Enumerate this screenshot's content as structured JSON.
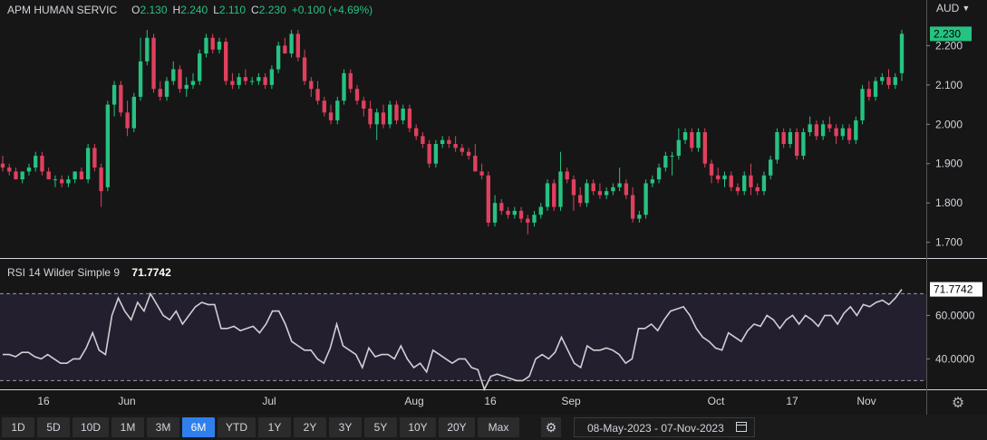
{
  "legend": {
    "symbol": "APM HUMAN SERVIC",
    "open_label": "O",
    "open": "2.130",
    "high_label": "H",
    "high": "2.240",
    "low_label": "L",
    "low": "2.110",
    "close_label": "C",
    "close": "2.230",
    "change": "+0.100 (+4.69%)"
  },
  "currency": "AUD",
  "currency_icon": "chevron-down-icon",
  "rsi_legend": {
    "name": "RSI 14 Wilder Simple 9",
    "value": "71.7742"
  },
  "colors": {
    "up": "#26c281",
    "down": "#e0405e",
    "rsi_line": "#cfcfd4",
    "rsi_band": "#231f2e",
    "active": "#2f80ed"
  },
  "toolbar": {
    "ranges": [
      "1D",
      "5D",
      "10D",
      "1M",
      "3M",
      "6M",
      "YTD",
      "1Y",
      "2Y",
      "3Y",
      "5Y",
      "10Y",
      "20Y",
      "Max"
    ],
    "active": "6M",
    "date_range": "08-May-2023 - 07-Nov-2023",
    "gear_icon": "gear-icon",
    "calendar_icon": "calendar-icon"
  },
  "settings_icon": "settings-icon",
  "chart_data": [
    {
      "type": "candlestick",
      "currency": "AUD",
      "last_price_label": "2.230",
      "y_ticks": [
        "2.200",
        "2.100",
        "2.000",
        "1.900",
        "1.800",
        "1.700"
      ],
      "ylim": [
        1.66,
        2.27
      ],
      "x_ticks": [
        "16",
        "Jun",
        "Jul",
        "Aug",
        "16",
        "Sep",
        "Oct",
        "17",
        "Nov"
      ],
      "candles": [
        [
          1.9,
          1.92,
          1.88,
          1.89
        ],
        [
          1.89,
          1.9,
          1.87,
          1.88
        ],
        [
          1.88,
          1.89,
          1.86,
          1.86
        ],
        [
          1.86,
          1.88,
          1.85,
          1.88
        ],
        [
          1.88,
          1.9,
          1.87,
          1.89
        ],
        [
          1.89,
          1.93,
          1.88,
          1.92
        ],
        [
          1.92,
          1.93,
          1.87,
          1.88
        ],
        [
          1.88,
          1.89,
          1.86,
          1.86
        ],
        [
          1.86,
          1.87,
          1.84,
          1.86
        ],
        [
          1.86,
          1.87,
          1.84,
          1.85
        ],
        [
          1.85,
          1.87,
          1.84,
          1.86
        ],
        [
          1.86,
          1.88,
          1.85,
          1.88
        ],
        [
          1.88,
          1.89,
          1.86,
          1.86
        ],
        [
          1.86,
          1.95,
          1.85,
          1.94
        ],
        [
          1.94,
          1.95,
          1.88,
          1.89
        ],
        [
          1.89,
          1.9,
          1.79,
          1.83
        ],
        [
          1.84,
          2.06,
          1.83,
          2.05
        ],
        [
          2.05,
          2.11,
          2.02,
          2.1
        ],
        [
          2.1,
          2.11,
          2.02,
          2.03
        ],
        [
          2.03,
          2.06,
          1.97,
          1.99
        ],
        [
          1.99,
          2.08,
          1.98,
          2.07
        ],
        [
          2.07,
          2.22,
          2.06,
          2.16
        ],
        [
          2.16,
          2.24,
          2.15,
          2.22
        ],
        [
          2.22,
          2.23,
          2.08,
          2.09
        ],
        [
          2.09,
          2.11,
          2.06,
          2.07
        ],
        [
          2.07,
          2.12,
          2.06,
          2.11
        ],
        [
          2.11,
          2.16,
          2.1,
          2.14
        ],
        [
          2.14,
          2.15,
          2.08,
          2.09
        ],
        [
          2.09,
          2.12,
          2.07,
          2.1
        ],
        [
          2.1,
          2.13,
          2.09,
          2.11
        ],
        [
          2.11,
          2.19,
          2.1,
          2.18
        ],
        [
          2.18,
          2.23,
          2.17,
          2.22
        ],
        [
          2.22,
          2.23,
          2.18,
          2.19
        ],
        [
          2.19,
          2.22,
          2.18,
          2.21
        ],
        [
          2.21,
          2.22,
          2.1,
          2.11
        ],
        [
          2.11,
          2.13,
          2.09,
          2.1
        ],
        [
          2.1,
          2.13,
          2.09,
          2.12
        ],
        [
          2.12,
          2.14,
          2.1,
          2.11
        ],
        [
          2.11,
          2.12,
          2.1,
          2.11
        ],
        [
          2.11,
          2.13,
          2.1,
          2.12
        ],
        [
          2.12,
          2.13,
          2.09,
          2.1
        ],
        [
          2.1,
          2.15,
          2.09,
          2.14
        ],
        [
          2.14,
          2.21,
          2.13,
          2.2
        ],
        [
          2.2,
          2.22,
          2.18,
          2.18
        ],
        [
          2.18,
          2.24,
          2.17,
          2.23
        ],
        [
          2.23,
          2.24,
          2.16,
          2.17
        ],
        [
          2.17,
          2.19,
          2.1,
          2.11
        ],
        [
          2.11,
          2.12,
          2.07,
          2.09
        ],
        [
          2.09,
          2.11,
          2.05,
          2.06
        ],
        [
          2.06,
          2.07,
          2.02,
          2.03
        ],
        [
          2.03,
          2.05,
          2.0,
          2.01
        ],
        [
          2.01,
          2.07,
          2.0,
          2.06
        ],
        [
          2.06,
          2.14,
          2.05,
          2.13
        ],
        [
          2.13,
          2.14,
          2.08,
          2.09
        ],
        [
          2.09,
          2.1,
          2.05,
          2.06
        ],
        [
          2.06,
          2.07,
          2.02,
          2.04
        ],
        [
          2.04,
          2.06,
          1.99,
          2.0
        ],
        [
          2.0,
          2.04,
          1.96,
          2.03
        ],
        [
          2.03,
          2.05,
          1.99,
          2.0
        ],
        [
          2.0,
          2.06,
          1.99,
          2.05
        ],
        [
          2.05,
          2.06,
          2.0,
          2.01
        ],
        [
          2.01,
          2.05,
          2.0,
          2.04
        ],
        [
          2.04,
          2.05,
          1.98,
          1.99
        ],
        [
          1.99,
          2.0,
          1.96,
          1.97
        ],
        [
          1.97,
          1.98,
          1.94,
          1.95
        ],
        [
          1.95,
          1.96,
          1.89,
          1.9
        ],
        [
          1.9,
          1.96,
          1.89,
          1.95
        ],
        [
          1.95,
          1.97,
          1.94,
          1.96
        ],
        [
          1.96,
          1.97,
          1.94,
          1.95
        ],
        [
          1.95,
          1.97,
          1.93,
          1.94
        ],
        [
          1.94,
          1.95,
          1.92,
          1.93
        ],
        [
          1.93,
          1.94,
          1.91,
          1.92
        ],
        [
          1.92,
          1.95,
          1.9,
          1.88
        ],
        [
          1.88,
          1.9,
          1.86,
          1.87
        ],
        [
          1.87,
          1.88,
          1.74,
          1.75
        ],
        [
          1.75,
          1.82,
          1.74,
          1.8
        ],
        [
          1.8,
          1.81,
          1.77,
          1.78
        ],
        [
          1.78,
          1.79,
          1.76,
          1.77
        ],
        [
          1.77,
          1.79,
          1.76,
          1.78
        ],
        [
          1.78,
          1.79,
          1.75,
          1.76
        ],
        [
          1.76,
          1.77,
          1.72,
          1.75
        ],
        [
          1.75,
          1.78,
          1.74,
          1.77
        ],
        [
          1.77,
          1.8,
          1.76,
          1.79
        ],
        [
          1.79,
          1.86,
          1.78,
          1.85
        ],
        [
          1.85,
          1.86,
          1.78,
          1.79
        ],
        [
          1.79,
          1.93,
          1.78,
          1.88
        ],
        [
          1.88,
          1.89,
          1.85,
          1.86
        ],
        [
          1.86,
          1.87,
          1.78,
          1.82
        ],
        [
          1.82,
          1.84,
          1.79,
          1.8
        ],
        [
          1.8,
          1.86,
          1.79,
          1.85
        ],
        [
          1.85,
          1.86,
          1.82,
          1.83
        ],
        [
          1.83,
          1.85,
          1.81,
          1.82
        ],
        [
          1.82,
          1.84,
          1.81,
          1.83
        ],
        [
          1.83,
          1.85,
          1.82,
          1.84
        ],
        [
          1.84,
          1.89,
          1.83,
          1.85
        ],
        [
          1.85,
          1.86,
          1.81,
          1.82
        ],
        [
          1.82,
          1.84,
          1.75,
          1.76
        ],
        [
          1.76,
          1.78,
          1.75,
          1.77
        ],
        [
          1.77,
          1.86,
          1.76,
          1.85
        ],
        [
          1.85,
          1.87,
          1.84,
          1.86
        ],
        [
          1.86,
          1.9,
          1.85,
          1.89
        ],
        [
          1.89,
          1.93,
          1.88,
          1.92
        ],
        [
          1.92,
          1.93,
          1.87,
          1.92
        ],
        [
          1.92,
          1.99,
          1.91,
          1.96
        ],
        [
          1.96,
          1.99,
          1.95,
          1.98
        ],
        [
          1.98,
          1.99,
          1.93,
          1.94
        ],
        [
          1.94,
          1.99,
          1.93,
          1.98
        ],
        [
          1.98,
          1.99,
          1.89,
          1.9
        ],
        [
          1.9,
          1.91,
          1.85,
          1.87
        ],
        [
          1.87,
          1.89,
          1.85,
          1.86
        ],
        [
          1.86,
          1.88,
          1.84,
          1.87
        ],
        [
          1.87,
          1.88,
          1.83,
          1.84
        ],
        [
          1.84,
          1.85,
          1.82,
          1.83
        ],
        [
          1.83,
          1.88,
          1.82,
          1.87
        ],
        [
          1.87,
          1.9,
          1.82,
          1.84
        ],
        [
          1.84,
          1.85,
          1.82,
          1.83
        ],
        [
          1.83,
          1.88,
          1.82,
          1.87
        ],
        [
          1.87,
          1.92,
          1.86,
          1.91
        ],
        [
          1.91,
          1.99,
          1.9,
          1.98
        ],
        [
          1.98,
          1.99,
          1.94,
          1.95
        ],
        [
          1.95,
          1.99,
          1.94,
          1.98
        ],
        [
          1.98,
          1.99,
          1.91,
          1.92
        ],
        [
          1.92,
          1.99,
          1.91,
          1.98
        ],
        [
          1.98,
          2.02,
          1.97,
          2.0
        ],
        [
          2.0,
          2.01,
          1.96,
          1.97
        ],
        [
          1.97,
          2.01,
          1.96,
          2.0
        ],
        [
          2.0,
          2.02,
          1.98,
          1.99
        ],
        [
          1.99,
          2.0,
          1.95,
          1.97
        ],
        [
          1.97,
          2.0,
          1.96,
          1.99
        ],
        [
          1.99,
          2.0,
          1.95,
          1.96
        ],
        [
          1.96,
          2.02,
          1.95,
          2.01
        ],
        [
          2.01,
          2.1,
          2.0,
          2.09
        ],
        [
          2.09,
          2.11,
          2.06,
          2.07
        ],
        [
          2.07,
          2.12,
          2.06,
          2.11
        ],
        [
          2.11,
          2.13,
          2.1,
          2.12
        ],
        [
          2.12,
          2.14,
          2.09,
          2.1
        ],
        [
          2.1,
          2.13,
          2.09,
          2.12
        ],
        [
          2.13,
          2.24,
          2.11,
          2.23
        ]
      ]
    },
    {
      "type": "line",
      "name": "RSI 14 Wilder Simple 9",
      "last_value_label": "71.7742",
      "y_ticks": [
        "60.0000",
        "40.0000"
      ],
      "reference_lines": [
        70,
        30
      ],
      "ylim": [
        26,
        76
      ],
      "values": [
        42,
        42,
        41,
        43,
        43,
        41,
        40,
        42,
        40,
        38,
        38,
        40,
        40,
        45,
        52,
        44,
        42,
        60,
        68,
        62,
        58,
        66,
        62,
        70,
        65,
        60,
        58,
        62,
        56,
        60,
        64,
        66,
        65,
        65,
        54,
        54,
        55,
        53,
        54,
        55,
        52,
        56,
        62,
        62,
        56,
        48,
        46,
        44,
        44,
        40,
        38,
        45,
        56,
        46,
        44,
        42,
        36,
        45,
        41,
        42,
        42,
        40,
        46,
        40,
        36,
        38,
        34,
        44,
        42,
        40,
        38,
        40,
        40,
        36,
        35,
        26,
        32,
        33,
        32,
        31,
        30,
        30,
        32,
        40,
        42,
        40,
        43,
        50,
        44,
        38,
        36,
        46,
        44,
        44,
        45,
        44,
        42,
        38,
        40,
        54,
        54,
        56,
        53,
        58,
        62,
        63,
        64,
        60,
        54,
        50,
        48,
        45,
        44,
        52,
        50,
        48,
        53,
        56,
        55,
        60,
        58,
        54,
        58,
        60,
        56,
        60,
        58,
        55,
        60,
        60,
        56,
        61,
        64,
        60,
        65,
        64,
        66,
        67,
        65,
        68,
        72
      ]
    }
  ]
}
